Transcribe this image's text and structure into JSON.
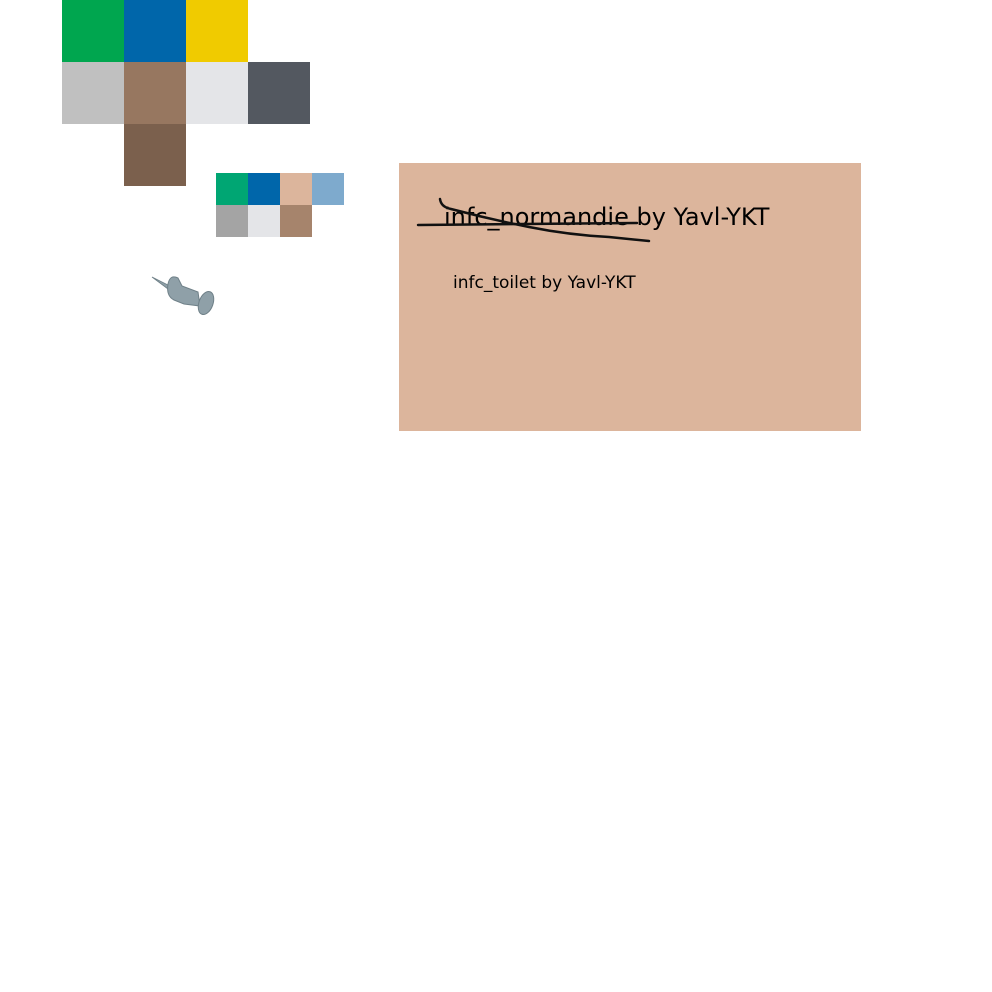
{
  "palette_large": {
    "row1": [
      "#00a64f",
      "#0066aa",
      "#f0cb00"
    ],
    "row2": [
      "#c0c0c0",
      "#977760",
      "#e4e5e8",
      "#535860"
    ],
    "row3": [
      "#7b604d"
    ]
  },
  "palette_small": {
    "row1": [
      "#00a673",
      "#0066aa",
      "#dcb59c",
      "#7eaacd"
    ],
    "row2": [
      "#a4a4a4",
      "#e4e5e8",
      "#a6846c"
    ]
  },
  "pin": {
    "icon": "pushpin-icon",
    "color": "#8fa0a8"
  },
  "note": {
    "background": "#dcb59c",
    "title": "infc_normandie by Yavl-YKT",
    "subtitle": "infc_toilet by Yavl-YKT"
  }
}
